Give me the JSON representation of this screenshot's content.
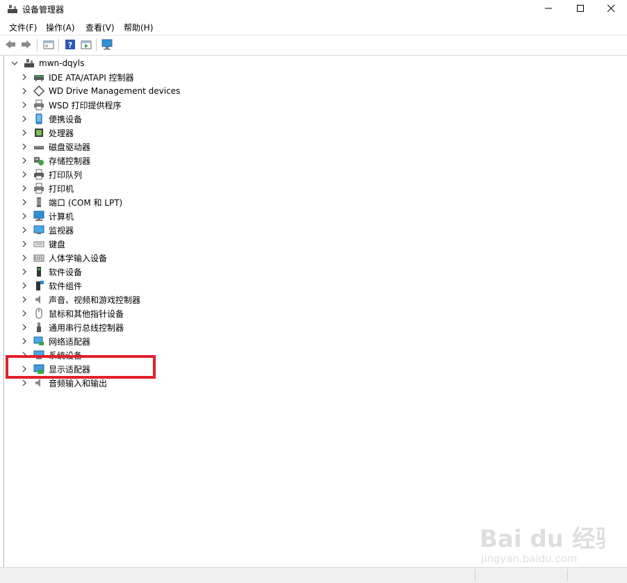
{
  "window": {
    "title": "设备管理器",
    "controls": [
      "minimize-icon",
      "maximize-icon",
      "close-icon"
    ]
  },
  "menu": [
    {
      "label": "文件(F)"
    },
    {
      "label": "操作(A)"
    },
    {
      "label": "查看(V)"
    },
    {
      "label": "帮助(H)"
    }
  ],
  "toolbar": {
    "buttons": [
      "back-arrow-icon",
      "forward-arrow-icon",
      "properties-sheet-icon",
      "help-icon",
      "run-action-icon",
      "monitor-scan-icon"
    ]
  },
  "tree": {
    "root": {
      "label": "mwn-dqyls",
      "icon": "computer-network-icon",
      "expanded": true
    },
    "items": [
      {
        "label": "IDE ATA/ATAPI 控制器",
        "icon": "ide-controller-icon"
      },
      {
        "label": "WD Drive Management devices",
        "icon": "wd-diamond-icon"
      },
      {
        "label": "WSD 打印提供程序",
        "icon": "printer-icon"
      },
      {
        "label": "便携设备",
        "icon": "portable-device-icon"
      },
      {
        "label": "处理器",
        "icon": "processor-icon"
      },
      {
        "label": "磁盘驱动器",
        "icon": "disk-drive-icon"
      },
      {
        "label": "存储控制器",
        "icon": "storage-controller-icon"
      },
      {
        "label": "打印队列",
        "icon": "print-queue-icon"
      },
      {
        "label": "打印机",
        "icon": "printer-icon"
      },
      {
        "label": "端口 (COM 和 LPT)",
        "icon": "port-icon"
      },
      {
        "label": "计算机",
        "icon": "computer-monitor-icon"
      },
      {
        "label": "监视器",
        "icon": "monitor-icon"
      },
      {
        "label": "键盘",
        "icon": "keyboard-icon"
      },
      {
        "label": "人体学输入设备",
        "icon": "hid-icon"
      },
      {
        "label": "软件设备",
        "icon": "software-device-icon"
      },
      {
        "label": "软件组件",
        "icon": "software-component-icon"
      },
      {
        "label": "声音、视频和游戏控制器",
        "icon": "speaker-icon"
      },
      {
        "label": "鼠标和其他指针设备",
        "icon": "mouse-icon"
      },
      {
        "label": "通用串行总线控制器",
        "icon": "usb-icon"
      },
      {
        "label": "网络适配器",
        "icon": "network-adapter-icon"
      },
      {
        "label": "系统设备",
        "icon": "system-device-icon"
      },
      {
        "label": "显示适配器",
        "icon": "display-adapter-icon",
        "highlighted": true
      },
      {
        "label": "音频输入和输出",
        "icon": "audio-io-icon"
      }
    ]
  },
  "watermark": {
    "brand": "Bai du 经验",
    "url": "jingyan.baidu.com"
  },
  "colors": {
    "highlight_border": "#e2202c",
    "icon_blue": "#2f8fd6",
    "icon_green": "#3fa34d"
  }
}
